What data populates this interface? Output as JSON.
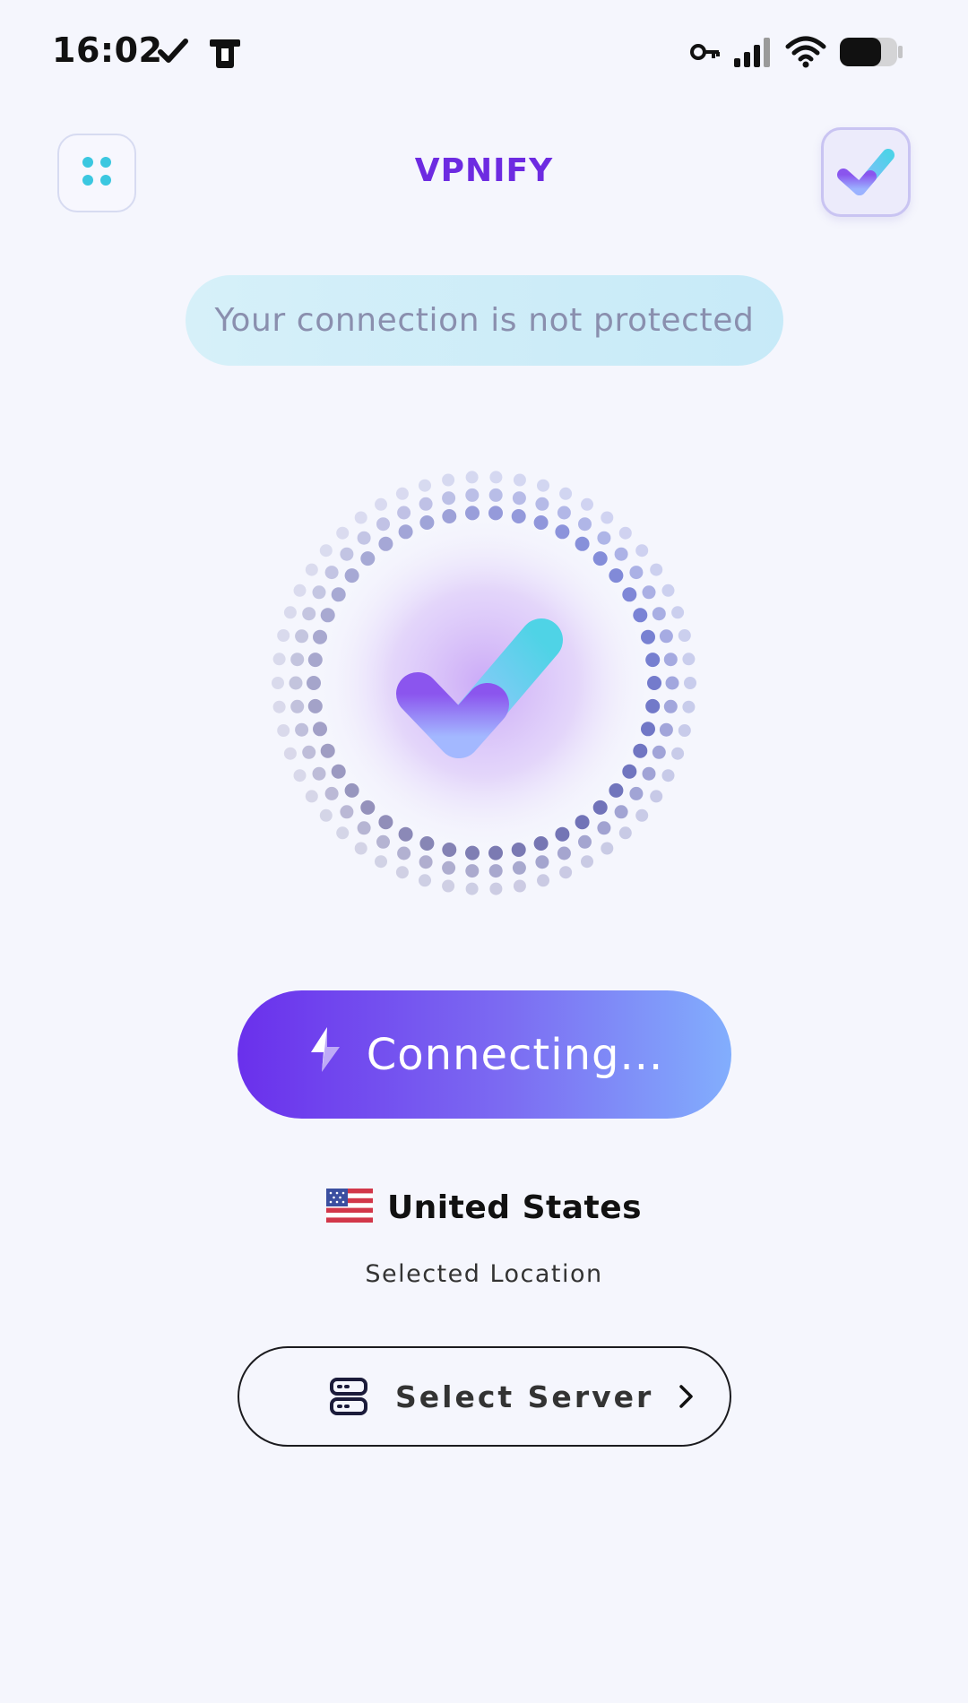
{
  "status_bar": {
    "time": "16:02"
  },
  "header": {
    "title": "VPNIFY",
    "menu_icon": "grid-dots-icon",
    "logo_icon": "check-logo-icon"
  },
  "status_message": "Your connection is not protected",
  "connect_button": {
    "label": "Connecting...",
    "icon": "bolt-icon"
  },
  "location": {
    "country": "United States",
    "flag_icon": "us-flag-icon",
    "caption": "Selected Location"
  },
  "server_button": {
    "label": "Select Server",
    "icon": "server-icon",
    "chevron": "chevron-right-icon"
  },
  "colors": {
    "accent": "#6d2be1",
    "background": "#f5f6fd",
    "pill": "#d3eef9",
    "button_start": "#6a30ec",
    "button_end": "#82aefd",
    "menu_dots": "#3bc7e0"
  }
}
